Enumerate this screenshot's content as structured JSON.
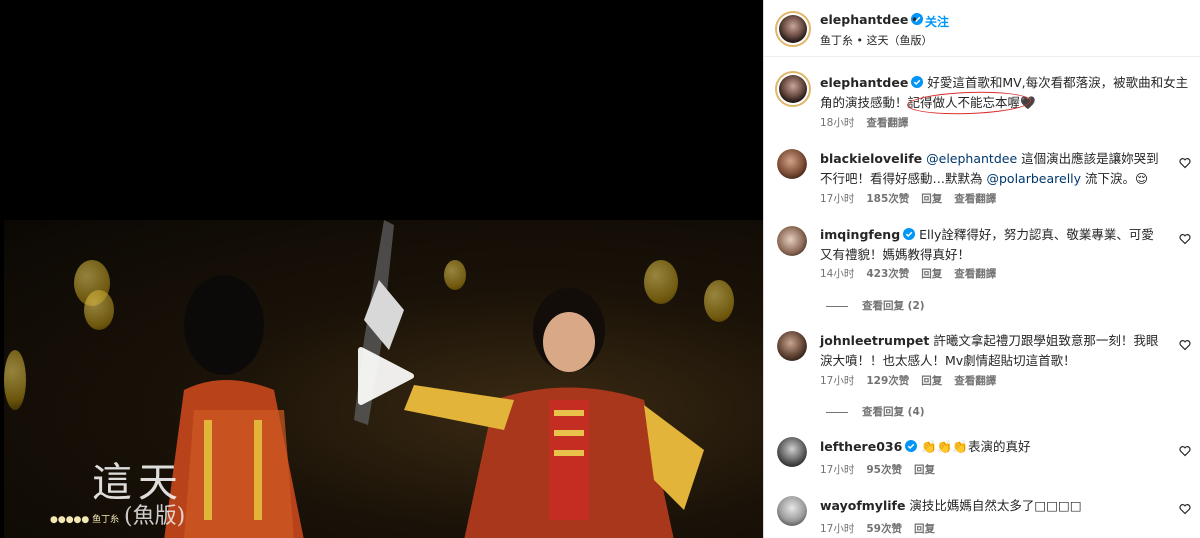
{
  "video": {
    "overlay_title": "這天",
    "overlay_subtitle": "(魚版)",
    "overlay_artist": "●●●●● 鱼丁糸"
  },
  "header": {
    "username": "elephantdee",
    "follow": "关注",
    "separator": "•",
    "music": "鱼丁糸 • 这天（鱼版）"
  },
  "caption": {
    "username": "elephantdee",
    "text": "好愛這首歌和MV,每次看都落淚，被歌曲和女主角的演技感動！記得做人不能忘本喔🖤",
    "time": "18小时",
    "translate": "查看翻譯"
  },
  "comments": [
    {
      "username": "blackielovelife",
      "mention1": "@elephantdee",
      "text_a": "這個演出應該是讓妳哭到不行吧！看得好感動…默默為",
      "mention2": "@polarbearelly",
      "text_b": "流下淚。😌",
      "time": "17小时",
      "likes": "185次赞",
      "reply": "回复",
      "translate": "查看翻譯"
    },
    {
      "username": "imqingfeng",
      "text": "Elly詮釋得好，努力認真、敬業專業、可愛又有禮貌！媽媽教得真好！",
      "time": "14小时",
      "likes": "423次赞",
      "reply": "回复",
      "translate": "查看翻譯",
      "view_replies": "查看回复 (2)"
    },
    {
      "username": "johnleetrumpet",
      "text": "許曦文拿起禮刀跟學姐致意那一刻！我眼淚大噴！！也太感人！Mv劇情超貼切這首歌！",
      "time": "17小时",
      "likes": "129次赞",
      "reply": "回复",
      "translate": "查看翻譯",
      "view_replies": "查看回复 (4)"
    },
    {
      "username": "lefthere036",
      "text": "👏👏👏表演的真好",
      "time": "17小时",
      "likes": "95次赞",
      "reply": "回复"
    },
    {
      "username": "wayofmylife",
      "text": "演技比媽媽自然太多了□□□□",
      "time": "17小时",
      "likes": "59次赞",
      "reply": "回复"
    }
  ],
  "colors": {
    "accent": "#0095f6",
    "verified": "#0095f6",
    "highlight": "#d9302c"
  }
}
